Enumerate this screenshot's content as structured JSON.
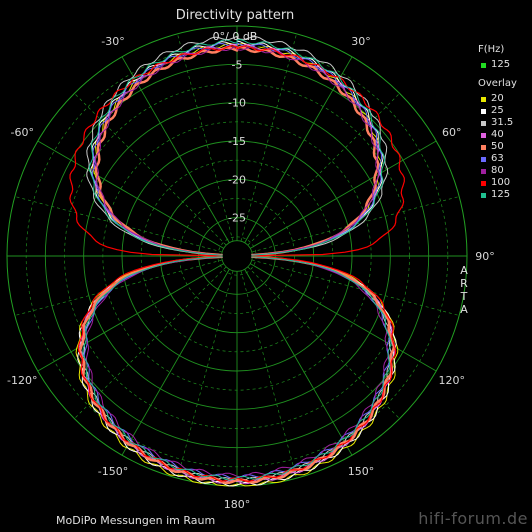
{
  "title": "Directivity pattern",
  "subtitle": "0°/ 0 dB",
  "footer_note": "MoDiPo Messungen im Raum",
  "watermark": "hifi-forum.de",
  "arta_label": "ARTA",
  "legend": {
    "freq_header": "F(Hz)",
    "freq_item": {
      "label": "125",
      "color": "#22dd22"
    },
    "overlay_header": "Overlay",
    "overlay_items": [
      {
        "label": "20",
        "color": "#e8e800"
      },
      {
        "label": "25",
        "color": "#ffffff"
      },
      {
        "label": "31.5",
        "color": "#c8c8c8"
      },
      {
        "label": "40",
        "color": "#e060e0"
      },
      {
        "label": "50",
        "color": "#ff8060"
      },
      {
        "label": "63",
        "color": "#6a6aff"
      },
      {
        "label": "80",
        "color": "#a020a0"
      },
      {
        "label": "100",
        "color": "#ff0000"
      },
      {
        "label": "125",
        "color": "#20c090"
      }
    ]
  },
  "chart_data": {
    "type": "polar",
    "radial_unit": "dB",
    "radial_range": [
      -30,
      0
    ],
    "radial_ticks": [
      -5,
      -10,
      -15,
      -20,
      -25
    ],
    "angle_ticks": [
      {
        "angle": 0,
        "label": "0°/ 0 dB"
      },
      {
        "angle": 30,
        "label": "30°"
      },
      {
        "angle": 60,
        "label": "60°"
      },
      {
        "angle": 90,
        "label": "90°"
      },
      {
        "angle": 120,
        "label": "120°"
      },
      {
        "angle": 150,
        "label": "150°"
      },
      {
        "angle": 180,
        "label": "180°"
      },
      {
        "angle": -150,
        "label": "-150°"
      },
      {
        "angle": -120,
        "label": "-120°"
      },
      {
        "angle": -90,
        "label": "-90°"
      },
      {
        "angle": -60,
        "label": "-60°"
      },
      {
        "angle": -30,
        "label": "-30°"
      }
    ],
    "grid": true,
    "legend_position": "right",
    "series": [
      {
        "name": "20",
        "color": "#e8e800",
        "front_db": -2.5,
        "back_db": 0,
        "null_db": -30,
        "width": 1.0
      },
      {
        "name": "25",
        "color": "#ffffff",
        "front_db": -2.2,
        "back_db": -0.2,
        "null_db": -30,
        "width": 1.0
      },
      {
        "name": "31.5",
        "color": "#c8c8c8",
        "front_db": -1.5,
        "back_db": -0.8,
        "null_db": -30,
        "width": 1.0
      },
      {
        "name": "40",
        "color": "#e060e0",
        "front_db": -2.6,
        "back_db": -0.5,
        "null_db": -30,
        "width": 1.0
      },
      {
        "name": "50",
        "color": "#ff8060",
        "front_db": -3.0,
        "back_db": -0.6,
        "null_db": -30,
        "width": 2.5
      },
      {
        "name": "63",
        "color": "#6a6aff",
        "front_db": -2.4,
        "back_db": -1.2,
        "null_db": -30,
        "width": 1.0
      },
      {
        "name": "80",
        "color": "#a020a0",
        "front_db": -2.9,
        "back_db": -1.4,
        "null_db": -30,
        "width": 1.0
      },
      {
        "name": "100",
        "color": "#ff0000",
        "front_db": -2.8,
        "back_db": -0.8,
        "null_db": -30,
        "width": 1.2,
        "shape": "wide"
      },
      {
        "name": "125",
        "color": "#20c090",
        "front_db": -2.0,
        "back_db": -1.0,
        "null_db": -30,
        "width": 1.0
      }
    ]
  }
}
